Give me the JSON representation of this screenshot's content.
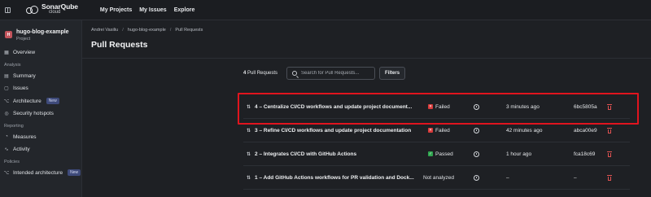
{
  "topbar": {
    "logo_brand": "SonarQube",
    "logo_sub": "cloud",
    "nav": [
      "My Projects",
      "My Issues",
      "Explore"
    ]
  },
  "project": {
    "avatar": "H",
    "name": "hugo-blog-example",
    "type": "Project"
  },
  "sidebar": {
    "overview": "Overview",
    "analysis_section": "Analysis",
    "summary": "Summary",
    "issues": "Issues",
    "architecture": "Architecture",
    "architecture_badge": "New",
    "security_hotspots": "Security hotspots",
    "reporting_section": "Reporting",
    "measures": "Measures",
    "activity": "Activity",
    "policies_section": "Policies",
    "intended_architecture": "Intended architecture",
    "intended_badge": "New"
  },
  "breadcrumb": [
    "Andrei Vasiliu",
    "hugo-blog-example",
    "Pull Requests"
  ],
  "breadcrumb_separator": "/",
  "page": {
    "title": "Pull Requests",
    "count_number": "4",
    "count_label": "Pull Requests",
    "search_placeholder": "Search for Pull Requests...",
    "filters_label": "Filters"
  },
  "pull_requests": [
    {
      "number": "4",
      "title": "4 – Centralize CI/CD workflows and update project document...",
      "status": "Failed",
      "status_kind": "failed",
      "time": "3 minutes ago",
      "sha": "6bc5805a"
    },
    {
      "number": "3",
      "title": "3 – Refine CI/CD workflows and update project documentation",
      "status": "Failed",
      "status_kind": "failed",
      "time": "42 minutes ago",
      "sha": "abca00e9"
    },
    {
      "number": "2",
      "title": "2 – Integrates CI/CD with GitHub Actions",
      "status": "Passed",
      "status_kind": "passed",
      "time": "1 hour ago",
      "sha": "fca18c69"
    },
    {
      "number": "1",
      "title": "1 – Add GitHub Actions workflows for PR validation and Dock...",
      "status": "Not analyzed",
      "status_kind": "none",
      "time": "–",
      "sha": "–"
    }
  ],
  "colors": {
    "background": "#1e2024",
    "failed": "#d83a3a",
    "passed": "#2fa64f",
    "highlight": "#e0141e",
    "delete": "#e05252"
  },
  "icons": {
    "sidebar_toggle": "sidebar-toggle-icon",
    "search": "search-icon",
    "pull_request": "pull-request-icon",
    "status_failed": "x-square-icon",
    "status_passed": "check-square-icon",
    "dev_branch": "dev-target-icon",
    "delete": "trash-icon"
  }
}
